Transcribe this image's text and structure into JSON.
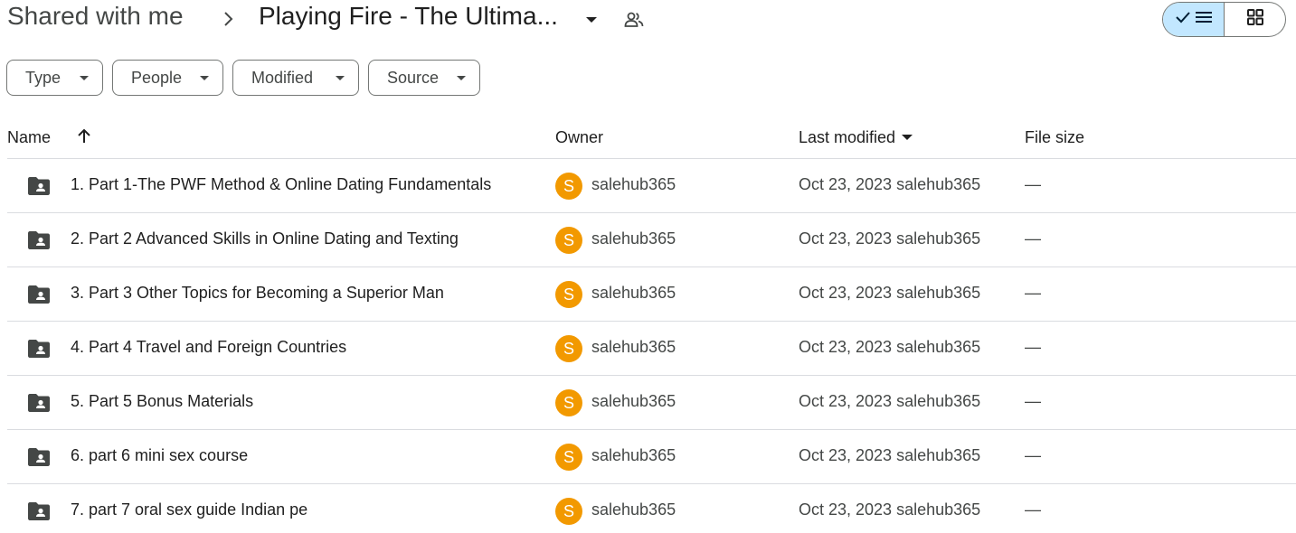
{
  "breadcrumb": {
    "root": "Shared with me",
    "current": "Playing Fire - The Ultima..."
  },
  "icons": {
    "separator": "chevron-right-icon",
    "caret": "arrow-drop-down-icon",
    "shared": "people-icon",
    "list_view": "check-list-icon",
    "grid_view": "grid-icon",
    "folder": "shared-folder-icon",
    "sort": "arrow-up-icon"
  },
  "filters": [
    {
      "label": "Type"
    },
    {
      "label": "People"
    },
    {
      "label": "Modified"
    },
    {
      "label": "Source"
    }
  ],
  "columns": {
    "name": "Name",
    "owner": "Owner",
    "last_modified": "Last modified",
    "file_size": "File size"
  },
  "rows": [
    {
      "name": "1. Part 1-The PWF Method & Online Dating Fundamentals",
      "avatar": "S",
      "owner": "salehub365",
      "modified": "Oct 23, 2023 salehub365",
      "size": "—"
    },
    {
      "name": "2. Part 2 Advanced Skills in Online Dating and Texting",
      "avatar": "S",
      "owner": "salehub365",
      "modified": "Oct 23, 2023 salehub365",
      "size": "—"
    },
    {
      "name": "3. Part 3 Other Topics for Becoming a Superior Man",
      "avatar": "S",
      "owner": "salehub365",
      "modified": "Oct 23, 2023 salehub365",
      "size": "—"
    },
    {
      "name": "4. Part 4 Travel and Foreign Countries",
      "avatar": "S",
      "owner": "salehub365",
      "modified": "Oct 23, 2023 salehub365",
      "size": "—"
    },
    {
      "name": "5. Part 5 Bonus Materials",
      "avatar": "S",
      "owner": "salehub365",
      "modified": "Oct 23, 2023 salehub365",
      "size": "—"
    },
    {
      "name": "6. part 6 mini sex course",
      "avatar": "S",
      "owner": "salehub365",
      "modified": "Oct 23, 2023 salehub365",
      "size": "—"
    },
    {
      "name": "7. part 7 oral sex guide Indian pe",
      "avatar": "S",
      "owner": "salehub365",
      "modified": "Oct 23, 2023 salehub365",
      "size": "—"
    }
  ],
  "colors": {
    "avatar": "#f29900",
    "view_selected": "#c2e7ff",
    "divider": "#dadce0",
    "outline": "#747775"
  }
}
